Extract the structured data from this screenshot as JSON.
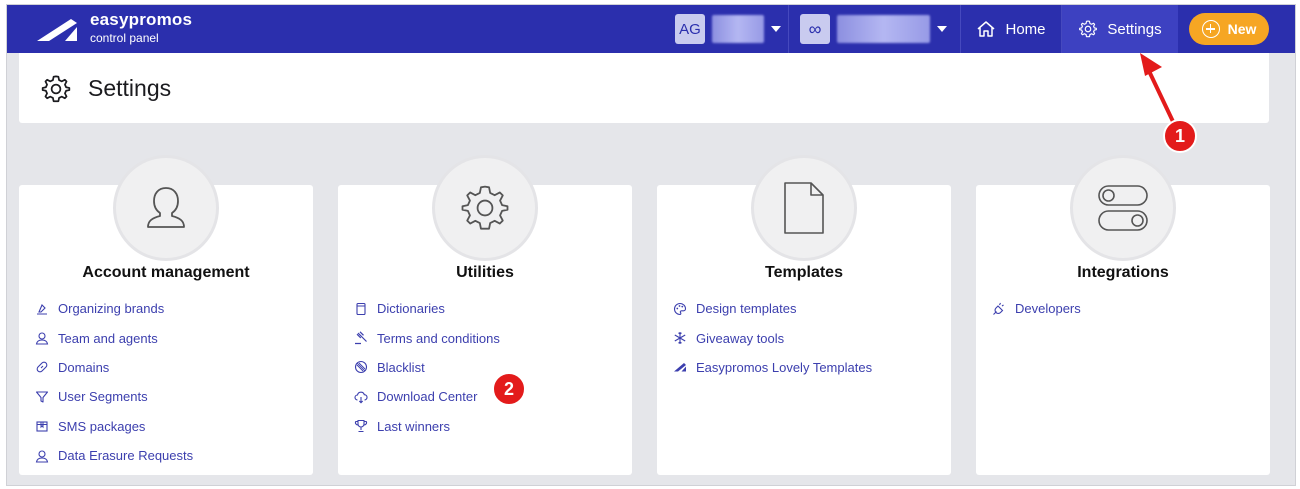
{
  "brand": {
    "name": "easypromos",
    "subtitle": "control panel"
  },
  "account_selector": {
    "initials": "AG"
  },
  "promo_selector": {
    "glyph": "∞"
  },
  "nav": {
    "home": "Home",
    "settings": "Settings",
    "new": "New"
  },
  "page": {
    "title": "Settings"
  },
  "cards": [
    {
      "title": "Account management",
      "icon": "user-icon",
      "links": [
        {
          "label": "Organizing brands",
          "icon": "brand-stamp-icon"
        },
        {
          "label": "Team and agents",
          "icon": "person-icon"
        },
        {
          "label": "Domains",
          "icon": "link-icon"
        },
        {
          "label": "User Segments",
          "icon": "filter-icon"
        },
        {
          "label": "SMS packages",
          "icon": "package-icon"
        },
        {
          "label": "Data Erasure Requests",
          "icon": "person-icon"
        }
      ]
    },
    {
      "title": "Utilities",
      "icon": "gear-icon",
      "links": [
        {
          "label": "Dictionaries",
          "icon": "book-icon"
        },
        {
          "label": "Terms and conditions",
          "icon": "gavel-icon"
        },
        {
          "label": "Blacklist",
          "icon": "block-icon"
        },
        {
          "label": "Download Center",
          "icon": "cloud-download-icon"
        },
        {
          "label": "Last winners",
          "icon": "trophy-icon"
        }
      ]
    },
    {
      "title": "Templates",
      "icon": "document-icon",
      "links": [
        {
          "label": "Design templates",
          "icon": "palette-icon"
        },
        {
          "label": "Giveaway tools",
          "icon": "snowflake-icon"
        },
        {
          "label": "Easypromos Lovely Templates",
          "icon": "easypromos-logo-icon"
        }
      ]
    },
    {
      "title": "Integrations",
      "icon": "toggles-icon",
      "links": [
        {
          "label": "Developers",
          "icon": "plug-icon"
        }
      ]
    }
  ],
  "annotations": {
    "marker_1": "1",
    "marker_2": "2"
  },
  "colors": {
    "topbar": "#2b2fad",
    "link": "#3c3fae",
    "new_button": "#f6a623",
    "marker": "#e31b1b",
    "background": "#e5e6ea"
  }
}
